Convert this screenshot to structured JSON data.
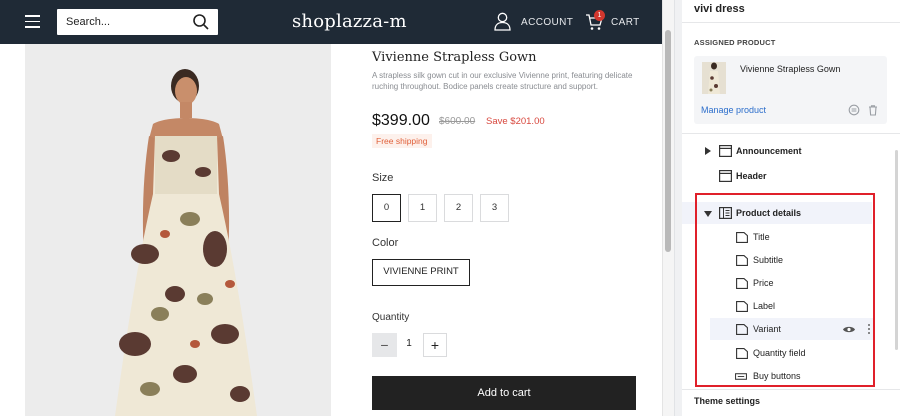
{
  "storefront": {
    "header": {
      "search_placeholder": "Search...",
      "logo_text": "shoplazza-m",
      "account_label": "ACCOUNT",
      "cart_label": "CART",
      "cart_count": "1",
      "background_color": "#1f2a36"
    },
    "product": {
      "title": "Vivienne Strapless Gown",
      "description": "A strapless silk gown cut in our exclusive Vivienne print, featuring delicate ruching throughout. Bodice panels create structure and support.",
      "price": "$399.00",
      "compare_price": "$600.00",
      "save_text": "Save $201.00",
      "shipping_badge": "Free shipping",
      "size_label": "Size",
      "sizes": [
        "0",
        "1",
        "2",
        "3"
      ],
      "selected_size": "0",
      "color_label": "Color",
      "color_value": "VIVIENNE PRINT",
      "quantity_label": "Quantity",
      "quantity": "1",
      "add_to_cart": "Add to cart"
    },
    "colors": {
      "save_red": "#d8483e",
      "shipping_orange": "#e0603a",
      "button_dark": "#222222"
    }
  },
  "panel": {
    "title": "vivi dress",
    "assigned_label": "ASSIGNED PRODUCT",
    "assigned_product_name": "Vivienne Strapless Gown",
    "manage_link": "Manage product",
    "sections": [
      {
        "label": "Announcement",
        "icon": "section-icon",
        "expanded": false
      },
      {
        "label": "Header",
        "icon": "section-icon",
        "expanded": false
      },
      {
        "label": "Product details",
        "icon": "product-details-icon",
        "expanded": true,
        "selected": true
      }
    ],
    "blocks": [
      {
        "label": "Title",
        "icon": "block-icon"
      },
      {
        "label": "Subtitle",
        "icon": "block-icon"
      },
      {
        "label": "Price",
        "icon": "block-icon"
      },
      {
        "label": "Label",
        "icon": "block-icon"
      },
      {
        "label": "Variant",
        "icon": "block-icon",
        "hovered": true
      },
      {
        "label": "Quantity field",
        "icon": "block-icon"
      },
      {
        "label": "Buy buttons",
        "icon": "button-block-icon"
      }
    ],
    "theme_settings": "Theme settings",
    "link_color": "#2c6ecb",
    "highlight_color": "#e0202a"
  }
}
